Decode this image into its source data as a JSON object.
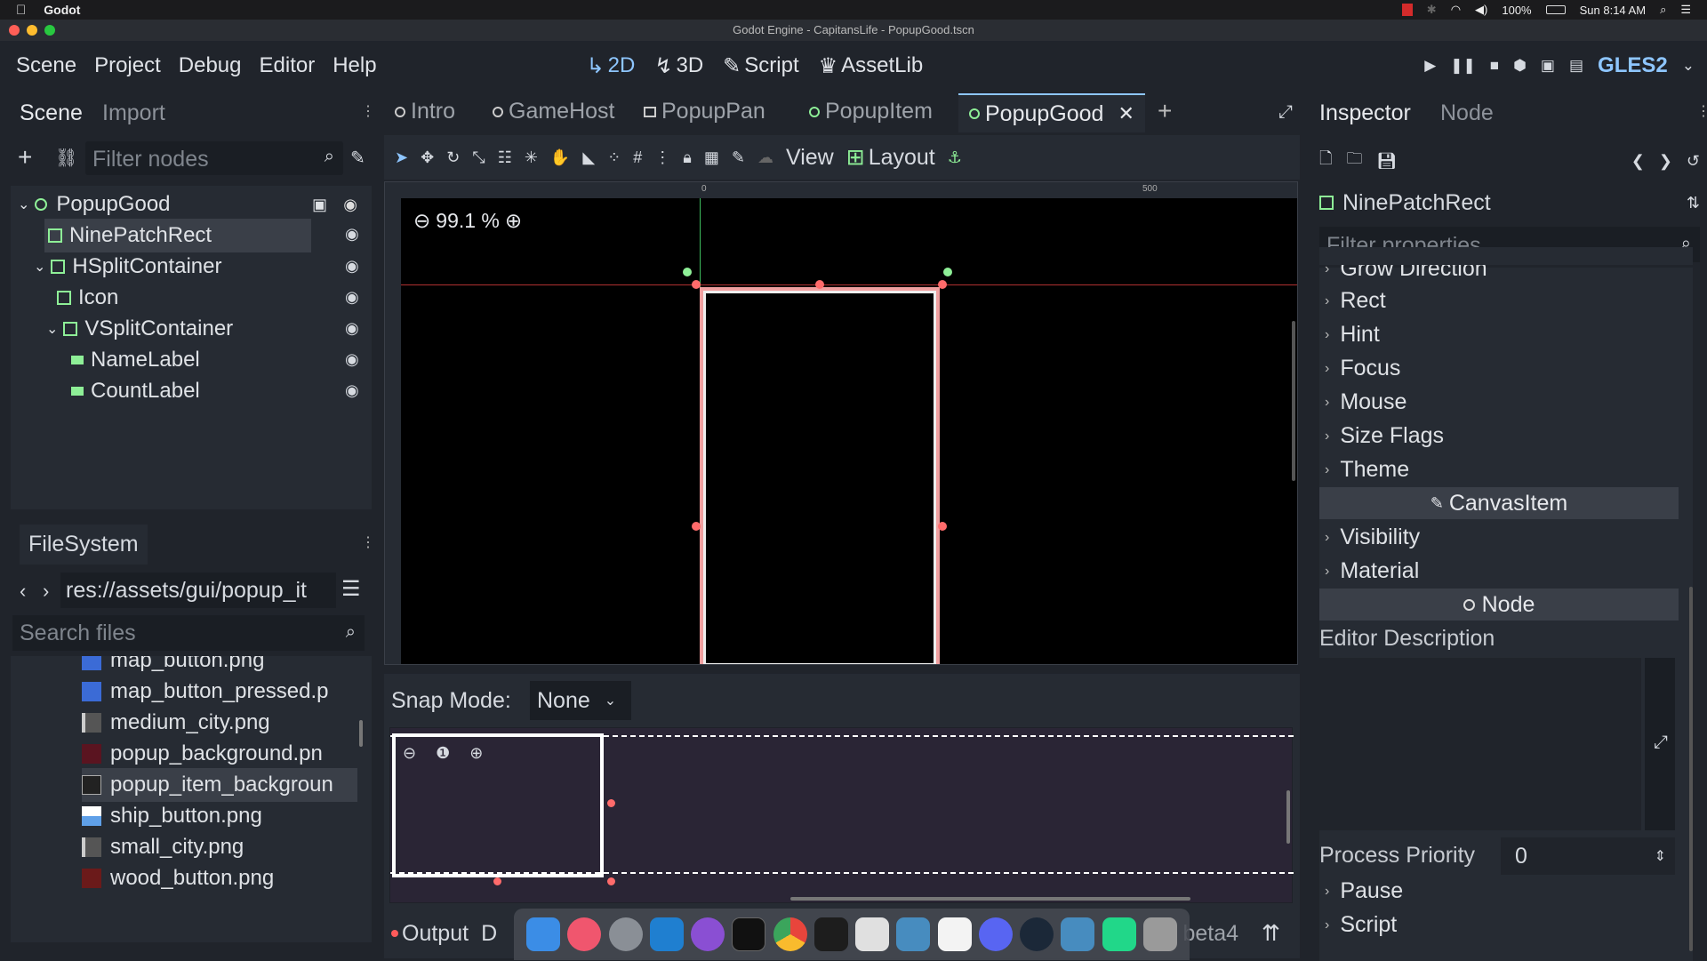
{
  "macbar": {
    "app_name": "Godot",
    "battery": "100%",
    "clock": "Sun 8:14 AM"
  },
  "window": {
    "title": "Godot Engine - CapitansLife - PopupGood.tscn"
  },
  "menus": [
    "Scene",
    "Project",
    "Debug",
    "Editor",
    "Help"
  ],
  "workspaces": [
    {
      "label": "2D",
      "active": true
    },
    {
      "label": "3D",
      "active": false
    },
    {
      "label": "Script",
      "active": false
    },
    {
      "label": "AssetLib",
      "active": false
    }
  ],
  "renderer": "GLES2",
  "scene_dock": {
    "tabs": [
      "Scene",
      "Import"
    ],
    "filter_placeholder": "Filter nodes",
    "nodes": [
      {
        "name": "PopupGood",
        "depth": 0,
        "icon": "control-node-icon",
        "color": "#8eef97"
      },
      {
        "name": "NinePatchRect",
        "depth": 1,
        "icon": "ninepatch-icon",
        "color": "#8eef97",
        "selected": true
      },
      {
        "name": "HSplitContainer",
        "depth": 1,
        "icon": "hsplit-icon",
        "color": "#8eef97"
      },
      {
        "name": "Icon",
        "depth": 2,
        "icon": "texture-rect-icon",
        "color": "#8eef97"
      },
      {
        "name": "VSplitContainer",
        "depth": 2,
        "icon": "vsplit-icon",
        "color": "#8eef97"
      },
      {
        "name": "NameLabel",
        "depth": 3,
        "icon": "label-icon",
        "color": "#8eef97"
      },
      {
        "name": "CountLabel",
        "depth": 3,
        "icon": "label-icon",
        "color": "#8eef97"
      }
    ]
  },
  "filesystem": {
    "title": "FileSystem",
    "path": "res://assets/gui/popup_it",
    "search_placeholder": "Search files",
    "files": [
      {
        "name": "map_button.png",
        "color": "#3b6bd6"
      },
      {
        "name": "map_button_pressed.p",
        "color": "#3b6bd6"
      },
      {
        "name": "medium_city.png",
        "color": "#cccccc"
      },
      {
        "name": "popup_background.pn",
        "color": "#5a1420"
      },
      {
        "name": "popup_item_backgroun",
        "color": "#222222",
        "selected": true
      },
      {
        "name": "ship_button.png",
        "color": "#5fa0e8"
      },
      {
        "name": "small_city.png",
        "color": "#cccccc"
      },
      {
        "name": "wood_button.png",
        "color": "#6b1a1a"
      }
    ]
  },
  "editor_tabs": [
    {
      "label": "Intro",
      "active": false
    },
    {
      "label": "GameHost",
      "active": false
    },
    {
      "label": "PopupPan",
      "active": false,
      "icon": "scene-icon"
    },
    {
      "label": "PopupItem",
      "active": false
    },
    {
      "label": "PopupGood",
      "active": true
    }
  ],
  "toolbar": {
    "view_label": "View",
    "layout_label": "Layout"
  },
  "viewport": {
    "zoom": "99.1 %",
    "ruler_zero": "0",
    "ruler_500": "500"
  },
  "bottom": {
    "snap_mode_label": "Snap Mode:",
    "snap_mode_value": "None",
    "output_label": "Output",
    "debugger_partial": "D",
    "version_partial": "beta4"
  },
  "inspector": {
    "tabs": [
      "Inspector",
      "Node"
    ],
    "node_name": "NinePatchRect",
    "filter_placeholder": "Filter properties",
    "partial_top": "Grow Direction",
    "control_props": [
      "Rect",
      "Hint",
      "Focus",
      "Mouse",
      "Size Flags",
      "Theme"
    ],
    "canvasitem_header": "CanvasItem",
    "canvasitem_props": [
      "Visibility",
      "Material"
    ],
    "node_header": "Node",
    "editor_description": "Editor Description",
    "process_priority_label": "Process Priority",
    "process_priority_value": "0",
    "node_props": [
      "Pause",
      "Script"
    ]
  },
  "dock_apps": [
    {
      "name": "finder",
      "color": "#3b8de6"
    },
    {
      "name": "music",
      "color": "#f0566e"
    },
    {
      "name": "system-preferences",
      "color": "#8a8f96"
    },
    {
      "name": "vscode",
      "color": "#1f7fd0"
    },
    {
      "name": "github-desktop",
      "color": "#8a4fd3"
    },
    {
      "name": "terminal",
      "color": "#111111"
    },
    {
      "name": "chrome",
      "color": "#e8453c"
    },
    {
      "name": "sourcetree",
      "color": "#1d1d1d"
    },
    {
      "name": "twitch",
      "color": "#e0e0e0"
    },
    {
      "name": "godot",
      "color": "#478cbf"
    },
    {
      "name": "notes",
      "color": "#f3f3f3"
    },
    {
      "name": "discord",
      "color": "#5865f2"
    },
    {
      "name": "steam",
      "color": "#1b2838"
    },
    {
      "name": "godot-2",
      "color": "#478cbf"
    },
    {
      "name": "clion",
      "color": "#21d789"
    },
    {
      "name": "trash",
      "color": "#9a9a9a"
    }
  ]
}
